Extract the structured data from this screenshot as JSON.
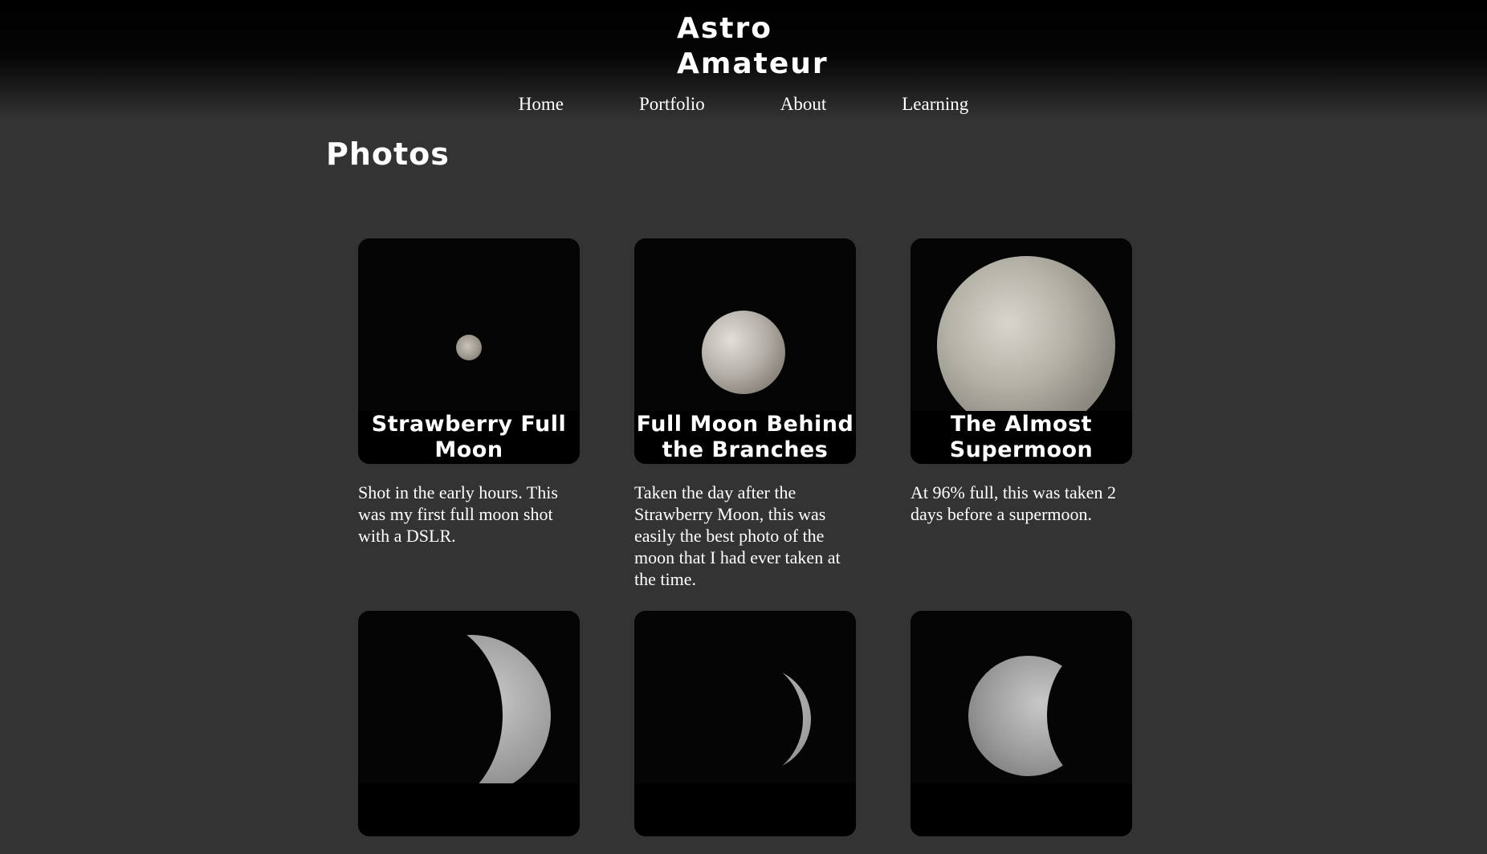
{
  "site": {
    "title_line1": "Astro",
    "title_line2": "Amateur"
  },
  "nav": {
    "items": [
      {
        "label": "Home"
      },
      {
        "label": "Portfolio"
      },
      {
        "label": "About"
      },
      {
        "label": "Learning"
      }
    ]
  },
  "page": {
    "heading": "Photos"
  },
  "photos": [
    {
      "title": "Strawberry Full Moon",
      "description": "Shot in the early hours. This was my first full moon shot with a DSLR."
    },
    {
      "title": "Full Moon Behind the Branches",
      "description": "Taken the day after the Strawberry Moon, this was easily the best photo of the moon that I had ever taken at the time."
    },
    {
      "title": "The Almost Supermoon",
      "description": "At 96% full, this was taken 2 days before a supermoon."
    },
    {
      "title": "",
      "description": ""
    },
    {
      "title": "",
      "description": ""
    },
    {
      "title": "",
      "description": ""
    }
  ],
  "colors": {
    "background": "#333333",
    "header_top": "#000000",
    "text": "#ffffff",
    "caption_bg": "#000000"
  }
}
